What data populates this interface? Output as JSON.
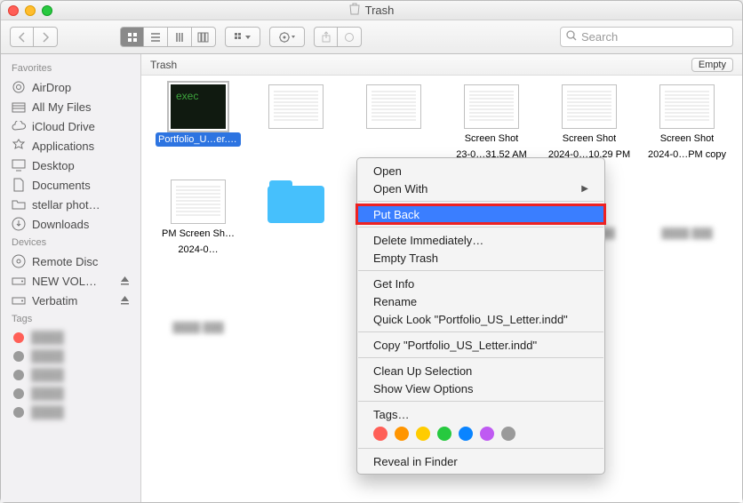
{
  "window": {
    "title": "Trash"
  },
  "toolbar": {
    "search_placeholder": "Search"
  },
  "pathbar": {
    "location": "Trash",
    "empty_button": "Empty"
  },
  "sidebar": {
    "sections": [
      {
        "heading": "Favorites",
        "items": [
          {
            "icon": "airdrop-icon",
            "label": "AirDrop"
          },
          {
            "icon": "all-my-files-icon",
            "label": "All My Files"
          },
          {
            "icon": "icloud-icon",
            "label": "iCloud Drive"
          },
          {
            "icon": "applications-icon",
            "label": "Applications"
          },
          {
            "icon": "desktop-icon",
            "label": "Desktop"
          },
          {
            "icon": "documents-icon",
            "label": "Documents"
          },
          {
            "icon": "folder-icon",
            "label": "stellar  phot…"
          },
          {
            "icon": "downloads-icon",
            "label": "Downloads"
          }
        ]
      },
      {
        "heading": "Devices",
        "items": [
          {
            "icon": "disc-icon",
            "label": "Remote Disc"
          },
          {
            "icon": "drive-icon",
            "label": "NEW VOL…",
            "eject": true
          },
          {
            "icon": "drive-icon",
            "label": "Verbatim",
            "eject": true
          }
        ]
      },
      {
        "heading": "Tags",
        "items": []
      }
    ],
    "tags": [
      {
        "color": "#ff5f57",
        "label": ""
      },
      {
        "color": "#9b9b9b",
        "label": ""
      },
      {
        "color": "#9b9b9b",
        "label": ""
      },
      {
        "color": "#9b9b9b",
        "label": ""
      },
      {
        "color": "#9b9b9b",
        "label": ""
      }
    ]
  },
  "files": [
    {
      "name": "Portfolio_US_Letter.indd",
      "display": "Portfolio_U…er.indd",
      "type": "exec",
      "selected": true
    },
    {
      "name": "",
      "display": "",
      "type": "doc"
    },
    {
      "name": "",
      "display": "",
      "type": "doc"
    },
    {
      "name": "Screen Shot 2023-0…31.52 AM",
      "display": "Screen Shot",
      "sub": "23-0…31.52 AM",
      "type": "image"
    },
    {
      "name": "Screen Shot 2024-0…10.29 PM",
      "display": "Screen Shot",
      "sub": "2024-0…10.29 PM",
      "type": "image"
    },
    {
      "name": "Screen Shot 2024-0…PM copy",
      "display": "Screen Shot",
      "sub": "2024-0…PM copy",
      "type": "image"
    },
    {
      "name": "Screen Shot 2024-0… PM",
      "display": "Screen Sh…",
      "sub": "2024-0…",
      "prefix": "PM",
      "type": "doc"
    },
    {
      "name": "",
      "display": "",
      "type": "folder"
    },
    {
      "name": "",
      "display": "",
      "type": "folder"
    },
    {
      "name": "",
      "display": "",
      "type": "folder"
    },
    {
      "name": "",
      "display": "",
      "type": "blur"
    },
    {
      "name": "",
      "display": "",
      "type": "blur"
    },
    {
      "name": "",
      "display": "",
      "type": "blur"
    }
  ],
  "contextmenu": {
    "groups": [
      [
        "Open",
        "Open With"
      ],
      [
        "Put Back"
      ],
      [
        "Delete Immediately…",
        "Empty Trash"
      ],
      [
        "Get Info",
        "Rename",
        "Quick Look \"Portfolio_US_Letter.indd\""
      ],
      [
        "Copy \"Portfolio_US_Letter.indd\""
      ],
      [
        "Clean Up Selection",
        "Show View Options"
      ],
      [
        "Tags…"
      ],
      [
        "Reveal in Finder"
      ]
    ],
    "highlighted": "Put Back",
    "submenu_item": "Open With",
    "tag_colors": [
      "#ff5f57",
      "#ff9500",
      "#ffcc00",
      "#27c93f",
      "#0a84ff",
      "#bf5af2",
      "#9a9a9a"
    ]
  }
}
